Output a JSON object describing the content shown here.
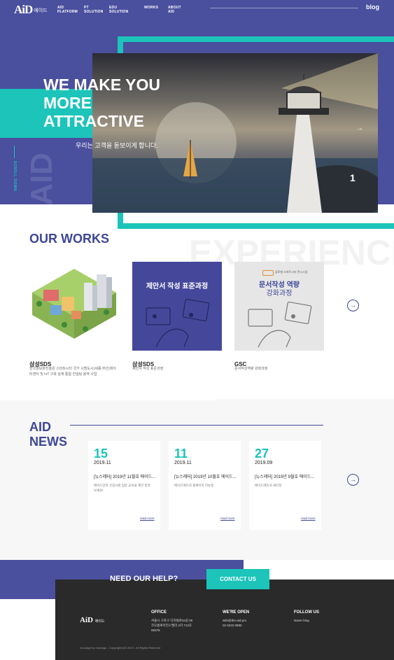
{
  "header": {
    "logo": "AiD",
    "logo_sub": "에이드",
    "nav": [
      "AID PLATFORM",
      "PT SOLUTION",
      "EDU SOLUTION",
      "WORKS",
      "ABOUT AID"
    ],
    "blog": "blog"
  },
  "hero": {
    "headline": [
      "WE MAKE YOU",
      "MORE",
      "ATTRACTIVE"
    ],
    "subline": "우리는 고객을 돋보이게 합니다.",
    "vertical_word": "AID",
    "scroll_label": "SCROLL DOWN",
    "slide_number": "1",
    "next_arrow": "→"
  },
  "works": {
    "title": "OUR WORKS",
    "background_word": "EXPERIENCE",
    "cards": [
      {
        "name": "삼성SDS",
        "desc": "한국정보화진흥원 스마트시티 국가 시범도시(세종,부산)데이터센터 및 IoT 구축 설계 통합 컨설팅 용역 사업"
      },
      {
        "name": "삼성SDS",
        "desc": "제안서 작성 표준과정",
        "image_text": "제안서 작성 표준과정"
      },
      {
        "name": "GSC",
        "desc": "문서작성역량 강화과정",
        "image_text": [
          "문서작성 역량",
          "강화과정"
        ],
        "image_logo": "글로벌 스마트시티 컨소시엄"
      }
    ],
    "next_icon": "→"
  },
  "news": {
    "title": [
      "AID",
      "NEWS"
    ],
    "items": [
      {
        "day": "15",
        "month": "2019.11",
        "headline": "[뉴스레터] 2019년 11월호 에이드...",
        "text": "에이드만의 신입사원 입문 교육을 제안 받아보세요!",
        "more": "read more"
      },
      {
        "day": "11",
        "month": "2019.11",
        "headline": "[뉴스레터] 2019년 10월호 에이드...",
        "text": "에이드에듀의 홈페이지 리뉴얼",
        "more": "read more"
      },
      {
        "day": "27",
        "month": "2019.09",
        "headline": "[뉴스레터] 2019년 9월호 에이드...",
        "text": "에이드에듀의 새단장",
        "more": "read more"
      }
    ],
    "next_icon": "→"
  },
  "help": {
    "text": "NEED OUR HELP?",
    "button": "CONTACT US"
  },
  "footer": {
    "logo": "AiD",
    "logo_sub": "에이드",
    "office_title": "OFFICE",
    "office_lines": [
      "서울시 구로구 디지털로34길 55",
      "코오롱싸이언스밸리 2차 713호",
      "08378"
    ],
    "open_title": "WE'RE OPEN",
    "open_lines": [
      "with@the-aid.pro",
      "02 6232 0880"
    ],
    "follow_title": "FOLLOW US",
    "follow_lines": [
      "Naver blog"
    ],
    "copyright": "muuisign by muuisign - Copyright AID 2019 - All Rights Reserved"
  }
}
